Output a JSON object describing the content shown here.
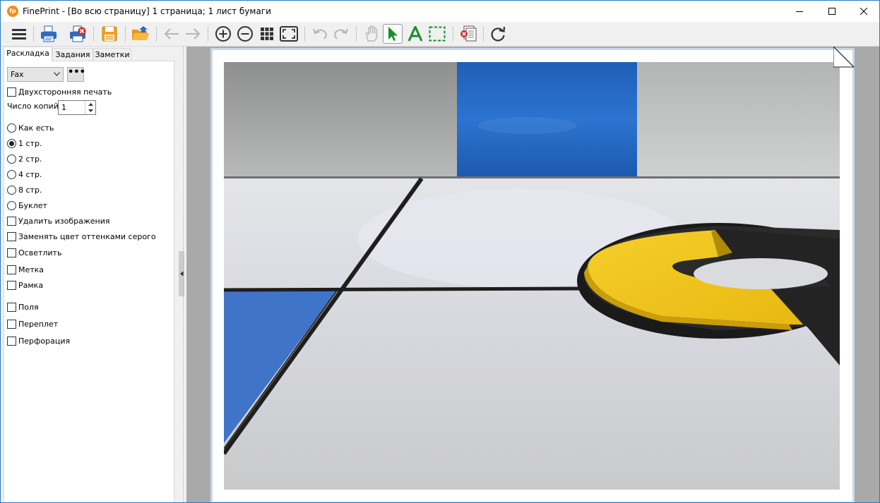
{
  "window": {
    "app_name": "FinePrint",
    "title": "FinePrint - [Во всю страницу] 1 страница; 1 лист бумаги",
    "icon_text": "fp"
  },
  "toolbar": {
    "buttons": [
      "menu-icon",
      "print-icon",
      "cancel-print-icon",
      "save-icon",
      "open-icon",
      "back-arrow-icon",
      "forward-arrow-icon",
      "zoom-in-icon",
      "zoom-out-icon",
      "grid-view-icon",
      "fit-page-icon",
      "undo-icon",
      "redo-icon",
      "hand-tool-icon",
      "select-arrow-icon",
      "text-tool-icon",
      "marquee-select-icon",
      "delete-page-icon",
      "refresh-icon"
    ]
  },
  "tabs": [
    {
      "label": "Раскладка",
      "active": true
    },
    {
      "label": "Задания",
      "active": false
    },
    {
      "label": "Заметки",
      "active": false
    }
  ],
  "layout": {
    "printer": "Fax",
    "more_button": "•••",
    "duplex_label": "Двухсторонняя печать",
    "duplex_checked": false,
    "copies_label": "Число копий:",
    "copies_value": "1",
    "pages_per_sheet": [
      {
        "label": "Как есть",
        "selected": false
      },
      {
        "label": "1 стр.",
        "selected": true
      },
      {
        "label": "2 стр.",
        "selected": false
      },
      {
        "label": "4 стр.",
        "selected": false
      },
      {
        "label": "8 стр.",
        "selected": false
      },
      {
        "label": "Буклет",
        "selected": false
      }
    ],
    "options": [
      {
        "label": "Удалить изображения",
        "checked": false
      },
      {
        "label": "Заменять цвет оттенками серого",
        "checked": false
      },
      {
        "label": "Осветлить",
        "checked": false
      },
      {
        "label": "Метка",
        "checked": false
      },
      {
        "label": "Рамка",
        "checked": false
      },
      {
        "label": "Поля",
        "checked": false
      },
      {
        "label": "Переплет",
        "checked": false
      },
      {
        "label": "Перфорация",
        "checked": false
      }
    ]
  },
  "colors": {
    "accent_blue": "#2b79c2",
    "folder_orange": "#f0a31c",
    "select_green": "#1a8c2a",
    "preview_bg": "#a9a9a9"
  }
}
